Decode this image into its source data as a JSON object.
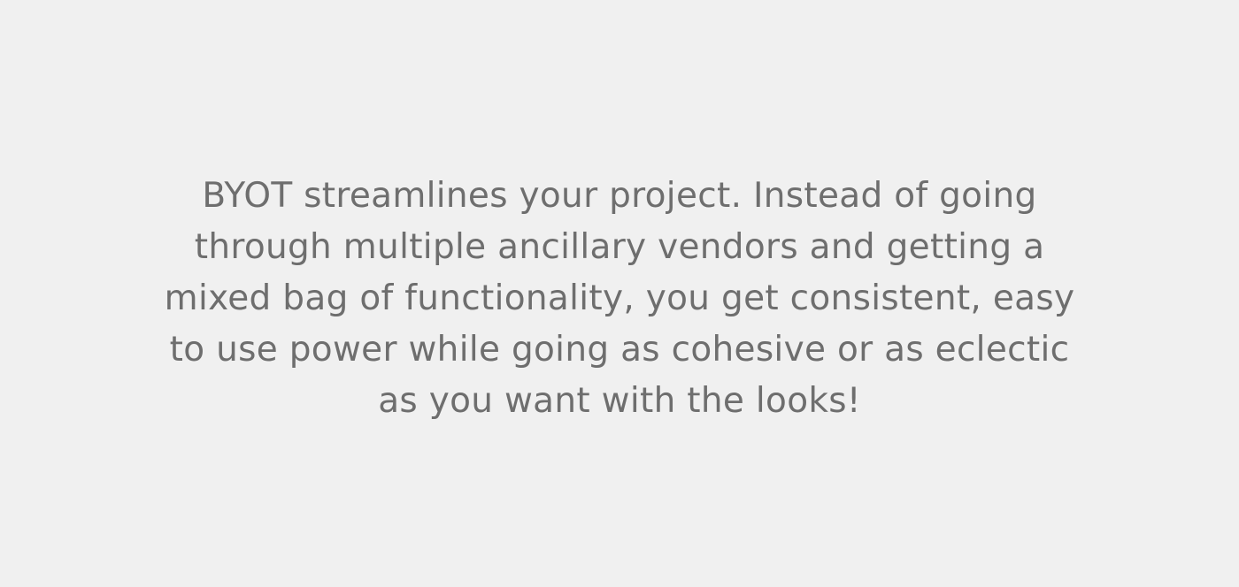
{
  "paragraph": {
    "lines": [
      "BYOT streamlines your project. Instead of going",
      "through multiple ancillary vendors and getting a",
      "mixed bag of functionality, you get consistent, easy",
      "to use power while going as cohesive or as eclectic",
      "as you want with the looks!"
    ]
  },
  "colors": {
    "background": "#f0f0f0",
    "text": "#6e6e6e"
  }
}
